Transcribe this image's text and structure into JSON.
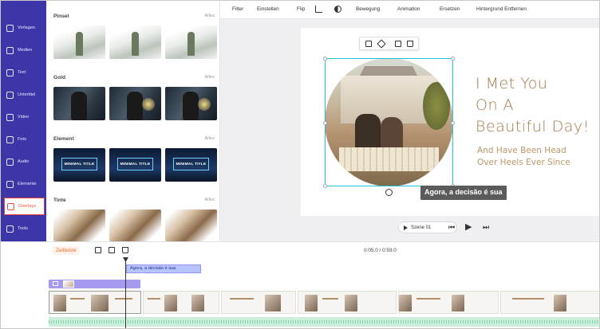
{
  "sidebar": {
    "items": [
      {
        "label": "Vorlagen",
        "icon": "layers-icon"
      },
      {
        "label": "Medien",
        "icon": "media-icon"
      },
      {
        "label": "Text",
        "icon": "text-icon"
      },
      {
        "label": "Untertitel",
        "icon": "subtitle-icon"
      },
      {
        "label": "Video",
        "icon": "video-icon"
      },
      {
        "label": "Foto",
        "icon": "photo-icon"
      },
      {
        "label": "Audio",
        "icon": "audio-icon"
      },
      {
        "label": "Elemente",
        "icon": "elements-icon"
      },
      {
        "label": "Overlays",
        "icon": "overlays-icon",
        "active": true
      },
      {
        "label": "Tools",
        "icon": "tools-icon"
      }
    ]
  },
  "panel": {
    "sections": [
      {
        "title": "Pinsel",
        "all": "Alles"
      },
      {
        "title": "Gold",
        "all": "Alles"
      },
      {
        "title": "Element",
        "all": "Alles",
        "thumb_text": "MINIMAL TITLE"
      },
      {
        "title": "Tinte",
        "all": "Alles"
      }
    ]
  },
  "toolbar": {
    "filter": "Filter",
    "einstellen": "Einstellen",
    "flip": "Flip",
    "bewegung": "Bewegung",
    "animation": "Animation",
    "ersetzen": "Ersetzen",
    "hintergrund": "Hintergrund Entfernen"
  },
  "canvas": {
    "headline": [
      "I Met You",
      "On A",
      "Beautiful Day!"
    ],
    "subline": [
      "And Have Been Head",
      "Over Heels Ever Since"
    ],
    "subtitle": "Agora, a decisão é sua",
    "scene_label": "Szene 01"
  },
  "timeline": {
    "zeitleiste": "Zeitleiste",
    "timecode": "0:05.0 / 0:59.0",
    "subtitle_clip": "Agora, a decisão é sua"
  },
  "colors": {
    "sidebar_bg": "#3d36a8",
    "accent": "#ef4b3e",
    "headline": "#a27a4d",
    "selection": "#23c1d6"
  }
}
